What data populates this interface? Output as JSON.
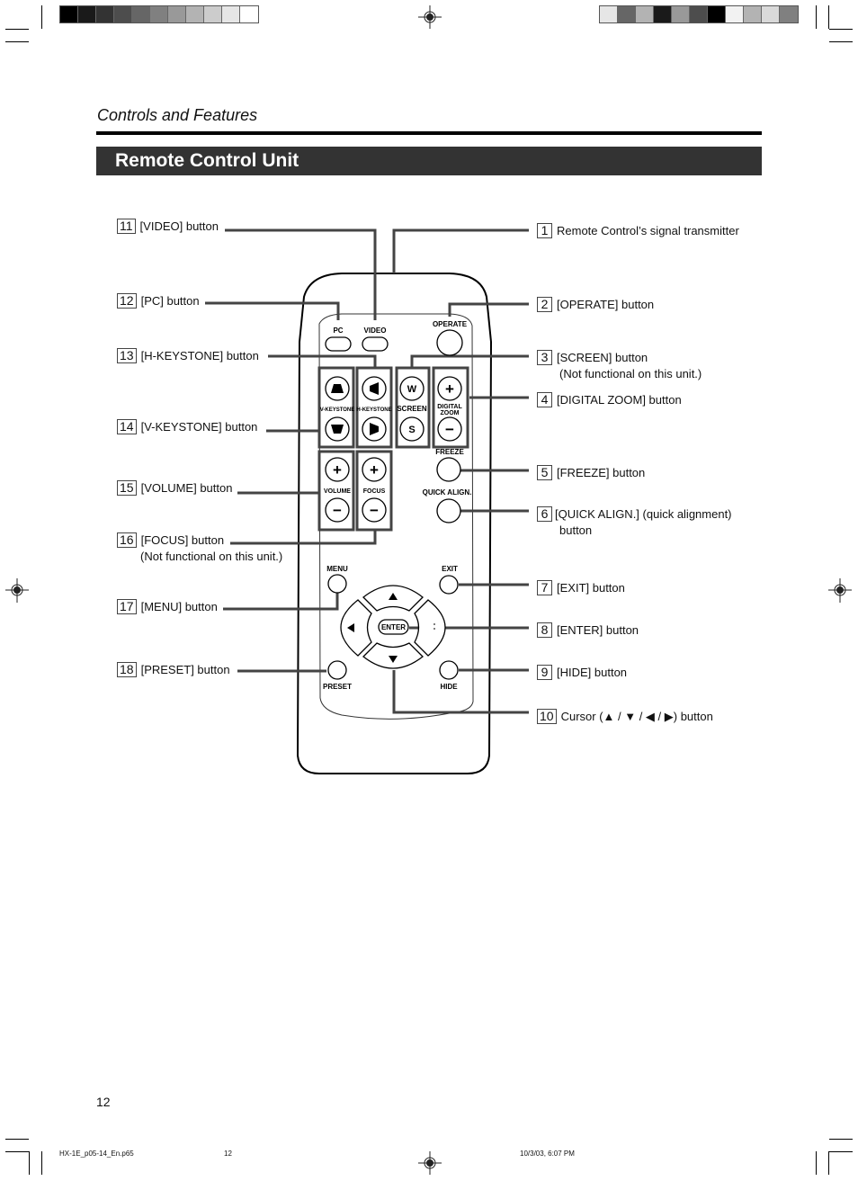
{
  "print_marks": {
    "left_swatches": [
      "#000000",
      "#1a1a1a",
      "#333333",
      "#4d4d4d",
      "#666666",
      "#808080",
      "#999999",
      "#b3b3b3",
      "#cccccc",
      "#e6e6e6",
      "#ffffff"
    ],
    "right_swatches": [
      "#e6e6e6",
      "#666666",
      "#b3b3b3",
      "#1a1a1a",
      "#999999",
      "#4d4d4d",
      "#000000",
      "#f2f2f2",
      "#b3b3b3",
      "#d9d9d9",
      "#808080"
    ]
  },
  "header": {
    "section_title": "Controls and Features",
    "banner_title": "Remote Control Unit"
  },
  "remote": {
    "labels": {
      "pc": "PC",
      "video": "VIDEO",
      "operate": "OPERATE",
      "v_keystone": "V-KEYSTONE",
      "h_keystone": "H-KEYSTONE",
      "screen": "SCREEN",
      "screen_w": "W",
      "screen_s": "S",
      "digital": "DIGITAL",
      "zoom": "ZOOM",
      "freeze": "FREEZE",
      "quick_align": "QUICK ALIGN.",
      "volume": "VOLUME",
      "focus": "FOCUS",
      "menu": "MENU",
      "exit": "EXIT",
      "enter": "ENTER",
      "preset": "PRESET",
      "hide": "HIDE",
      "plus": "+",
      "minus": "−"
    }
  },
  "callouts_right": [
    {
      "num": "1",
      "text": "Remote Control’s signal transmitter",
      "note": ""
    },
    {
      "num": "2",
      "text": "[OPERATE] button",
      "note": ""
    },
    {
      "num": "3",
      "text": "[SCREEN] button",
      "note": "(Not functional on this unit.)"
    },
    {
      "num": "4",
      "text": "[DIGITAL ZOOM] button",
      "note": ""
    },
    {
      "num": "5",
      "text": "[FREEZE] button",
      "note": ""
    },
    {
      "num": "6",
      "text": "[QUICK ALIGN.] (quick alignment)",
      "note": "button"
    },
    {
      "num": "7",
      "text": "[EXIT] button",
      "note": ""
    },
    {
      "num": "8",
      "text": "[ENTER] button",
      "note": ""
    },
    {
      "num": "9",
      "text": "[HIDE] button",
      "note": ""
    },
    {
      "num": "10",
      "text": "Cursor (▲ / ▼ / ◀ / ▶) button",
      "note": ""
    }
  ],
  "callouts_left": [
    {
      "num": "11",
      "text": "[VIDEO] button",
      "note": ""
    },
    {
      "num": "12",
      "text": "[PC] button",
      "note": ""
    },
    {
      "num": "13",
      "text": "[H-KEYSTONE] button",
      "note": ""
    },
    {
      "num": "14",
      "text": "[V-KEYSTONE] button",
      "note": ""
    },
    {
      "num": "15",
      "text": "[VOLUME] button",
      "note": ""
    },
    {
      "num": "16",
      "text": "[FOCUS] button",
      "note": "(Not functional on this unit.)"
    },
    {
      "num": "17",
      "text": "[MENU] button",
      "note": ""
    },
    {
      "num": "18",
      "text": "[PRESET] button",
      "note": ""
    }
  ],
  "footer": {
    "page_number": "12",
    "file_name": "HX-1E_p05-14_En.p65",
    "file_page": "12",
    "timestamp": "10/3/03, 6:07 PM"
  }
}
